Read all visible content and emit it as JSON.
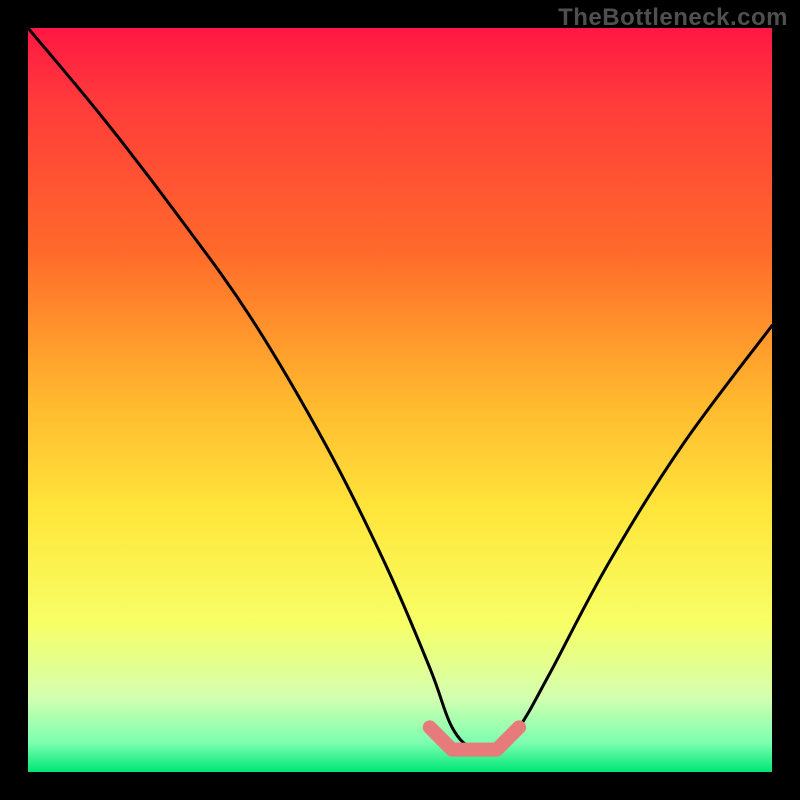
{
  "watermark": "TheBottleneck.com",
  "chart_data": {
    "type": "line",
    "title": "",
    "xlabel": "",
    "ylabel": "",
    "xlim": [
      0,
      100
    ],
    "ylim": [
      0,
      100
    ],
    "series": [
      {
        "name": "bottleneck-curve",
        "x": [
          0,
          10,
          20,
          30,
          40,
          48,
          54,
          57,
          60,
          63,
          66,
          70,
          78,
          88,
          100
        ],
        "values": [
          100,
          88,
          75,
          61,
          44,
          28,
          14,
          6,
          3,
          3,
          6,
          13,
          28,
          44,
          60
        ]
      },
      {
        "name": "optimal-range-highlight",
        "x": [
          54,
          57,
          60,
          63,
          66
        ],
        "values": [
          6,
          3,
          3,
          3,
          6
        ]
      }
    ],
    "gradient_stops": [
      {
        "offset": 0.0,
        "color": "#ff1744"
      },
      {
        "offset": 0.1,
        "color": "#ff3b3b"
      },
      {
        "offset": 0.3,
        "color": "#ff6a2a"
      },
      {
        "offset": 0.5,
        "color": "#ffb82e"
      },
      {
        "offset": 0.65,
        "color": "#ffe63b"
      },
      {
        "offset": 0.8,
        "color": "#f7ff66"
      },
      {
        "offset": 0.9,
        "color": "#d4ffb0"
      },
      {
        "offset": 0.96,
        "color": "#7dffb0"
      },
      {
        "offset": 1.0,
        "color": "#00e676"
      }
    ],
    "highlight_color": "#e77b7b",
    "curve_color": "#000000"
  }
}
